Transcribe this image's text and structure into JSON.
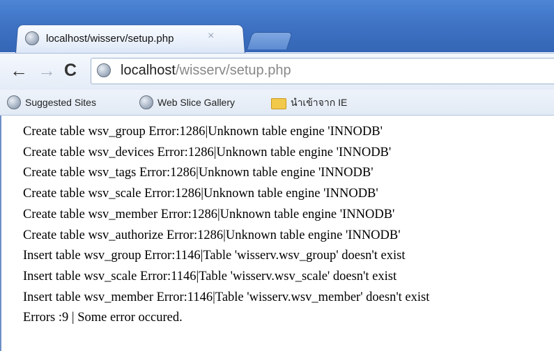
{
  "tab": {
    "title": "localhost/wisserv/setup.php",
    "close_icon": "×"
  },
  "toolbar": {
    "back_icon": "←",
    "forward_icon": "→",
    "reload_icon": "C",
    "url_host": "localhost",
    "url_path": "/wisserv/setup.php"
  },
  "bookmarks": [
    {
      "label": "Suggested Sites",
      "icon": "globe-icon"
    },
    {
      "label": "Web Slice Gallery",
      "icon": "globe-icon"
    },
    {
      "label": "นำเข้าจาก IE",
      "icon": "folder-icon"
    }
  ],
  "content": {
    "lines": [
      "Create table wsv_group Error:1286|Unknown table engine 'INNODB'",
      "Create table wsv_devices Error:1286|Unknown table engine 'INNODB'",
      "Create table wsv_tags Error:1286|Unknown table engine 'INNODB'",
      "Create table wsv_scale Error:1286|Unknown table engine 'INNODB'",
      "Create table wsv_member Error:1286|Unknown table engine 'INNODB'",
      "Create table wsv_authorize Error:1286|Unknown table engine 'INNODB'",
      "Insert table wsv_group Error:1146|Table 'wisserv.wsv_group' doesn't exist",
      "Insert table wsv_scale Error:1146|Table 'wisserv.wsv_scale' doesn't exist",
      "Insert table wsv_member Error:1146|Table 'wisserv.wsv_member' doesn't exist",
      "Errors :9 | Some error occured."
    ]
  }
}
